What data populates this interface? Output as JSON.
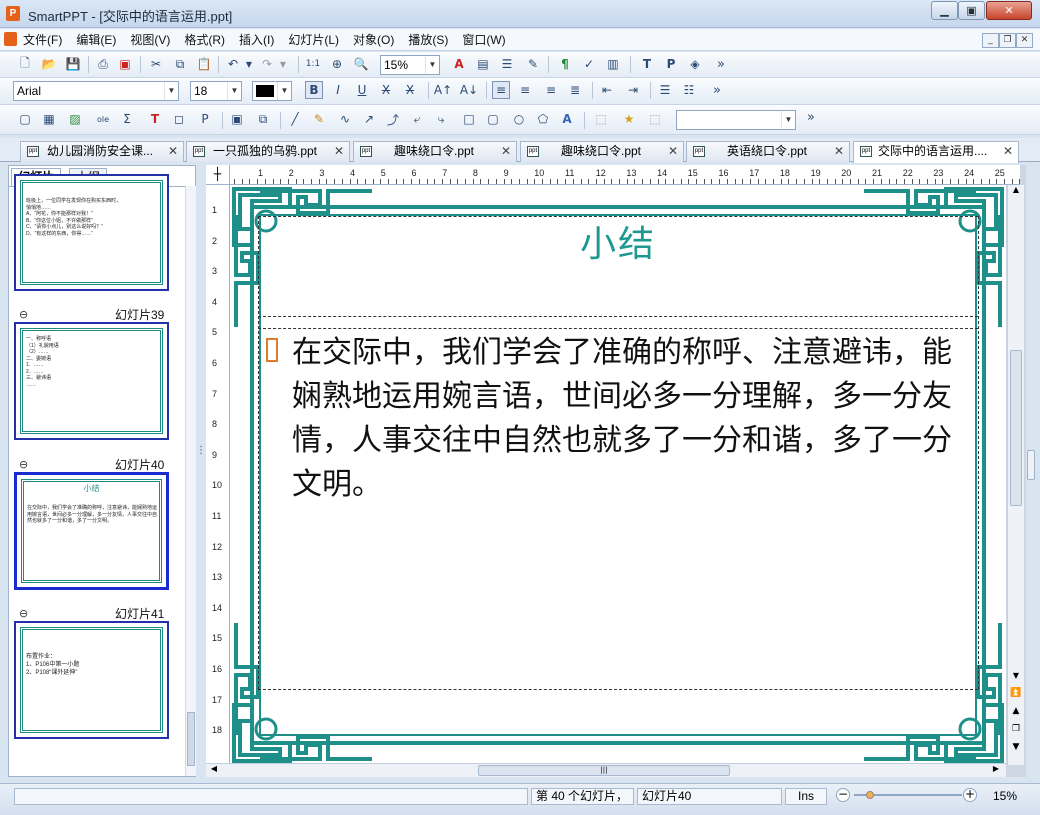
{
  "window": {
    "title": "SmartPPT - [交际中的语言运用.ppt]",
    "app_icon": "P"
  },
  "menu": [
    "文件(F)",
    "编辑(E)",
    "视图(V)",
    "格式(R)",
    "插入(I)",
    "幻灯片(L)",
    "对象(O)",
    "播放(S)",
    "窗口(W)"
  ],
  "toolbar": {
    "zoom": "15%",
    "font": "Arial",
    "size": "18",
    "more": "»"
  },
  "tabs": [
    {
      "label": "幼儿园消防安全课...",
      "active": false
    },
    {
      "label": "一只孤独的乌鸦.ppt",
      "active": false
    },
    {
      "label": "趣味绕口令.ppt",
      "active": false
    },
    {
      "label": "趣味绕口令.ppt",
      "active": false
    },
    {
      "label": "英语绕口令.ppt",
      "active": false
    },
    {
      "label": "交际中的语言运用....",
      "active": true
    }
  ],
  "side_panel": {
    "tab_slides": "幻灯片",
    "tab_outline": "大纲",
    "thumbs": [
      {
        "label": "",
        "title": "",
        "lines": "班级上，一位同学在发现你在购买东西时，\n悄悄地……\nA、“阿花，你不能那样对我！”\nB、“你这位小姐，不许做那样”\nC、“请你小点儿，别这么说好吗？”\nD、“有这样的东西，你得……”"
      },
      {
        "label": "幻灯片39",
        "title": "",
        "lines": "一、称呼语\n（1）礼貌用语\n（2）……\n二、委婉语\n1．……\n2．……\n三、避讳语\n……"
      },
      {
        "label": "幻灯片40",
        "title": "小结",
        "lines": "在交际中，我们学会了准确的称呼，注意避讳，能娴熟地运用婉言语，世间必多一分理解，多一分友情，人事交往中自然也就多了一分和谐，多了一分文明。"
      },
      {
        "label": "幻灯片41",
        "title": "",
        "lines": "布置作业：\n1、P106中第一小题\n2、P108“课外延伸”"
      }
    ]
  },
  "slide": {
    "title": "小结",
    "body": "在交际中，我们学会了准确的称呼、注意避讳，能娴熟地运用婉言语，世间必多一分理解，多一分友情，人事交往中自然也就多了一分和谐，多了一分文明。",
    "accent_color": "#1f9890"
  },
  "ruler_h": [
    "1",
    "2",
    "3",
    "4",
    "5",
    "6",
    "7",
    "8",
    "9",
    "10",
    "11",
    "12",
    "13",
    "14",
    "15",
    "16",
    "17",
    "18",
    "19",
    "20",
    "21",
    "22",
    "23",
    "24",
    "25"
  ],
  "ruler_v": [
    "1",
    "2",
    "3",
    "4",
    "5",
    "6",
    "7",
    "8",
    "9",
    "10",
    "11",
    "12",
    "13",
    "14",
    "15",
    "16",
    "17",
    "18"
  ],
  "status": {
    "slide_pos": "第 40 个幻灯片，",
    "slide_name": "幻灯片40",
    "mode": "Ins",
    "zoom": "15%"
  }
}
